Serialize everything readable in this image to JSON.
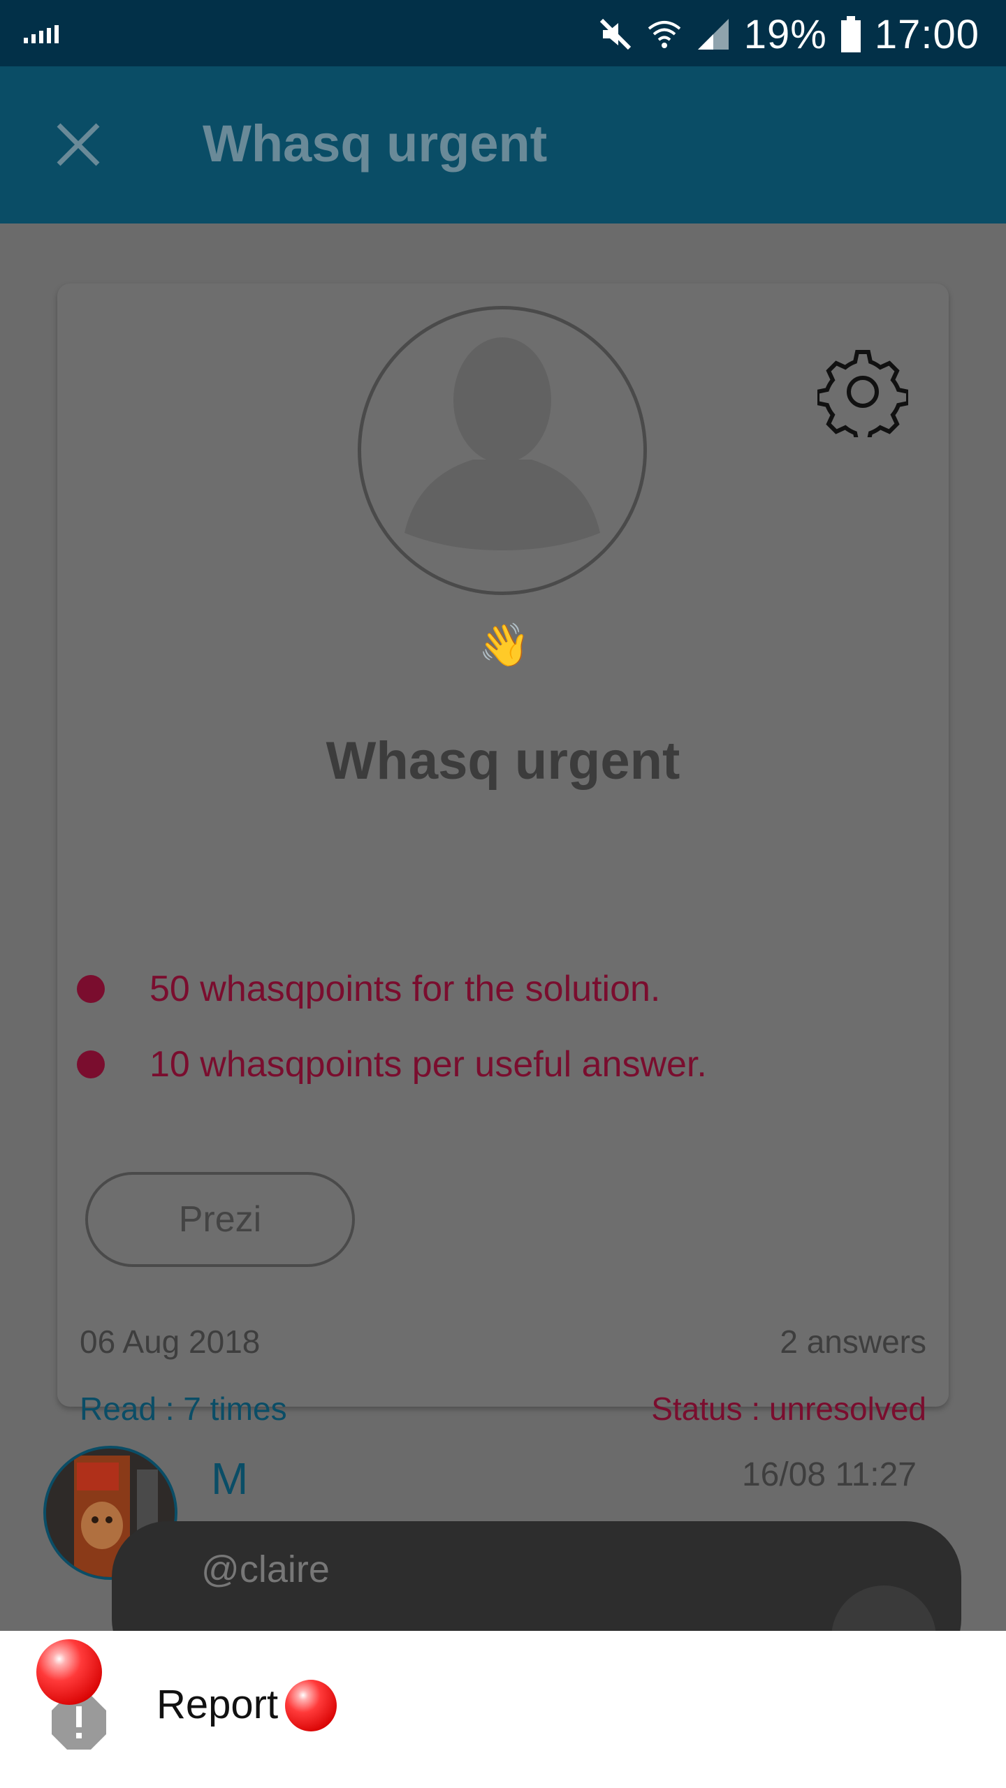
{
  "status_bar": {
    "battery": "19%",
    "time": "17:00"
  },
  "app_bar": {
    "title": "Whasq urgent"
  },
  "card": {
    "title": "Whasq urgent",
    "bullets": [
      "50 whasqpoints for the solution.",
      "10 whasqpoints per useful answer."
    ],
    "prezi_label": "Prezi",
    "date": "06 Aug 2018",
    "answers": "2 answers",
    "read": "Read : 7 times",
    "status": "Status : unresolved"
  },
  "answer": {
    "author": "M",
    "time": "16/08 11:27",
    "text": "@claire"
  },
  "bottom_sheet": {
    "report_label": "Report"
  },
  "colors": {
    "status_bar": "#023048",
    "app_bar": "#0a4d66",
    "overlay_bg": "#6b6b6b",
    "accent_red": "#7a0d2e"
  }
}
